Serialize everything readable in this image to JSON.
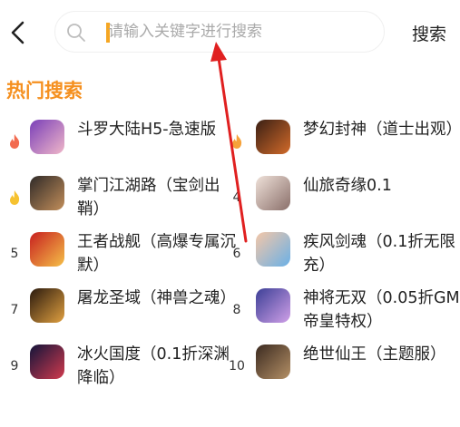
{
  "header": {
    "search_placeholder": "请输入关键字进行搜索",
    "search_button": "搜索"
  },
  "section_title": "热门搜索",
  "items": [
    {
      "rank": "1",
      "name": "斗罗大陆H5-急速版",
      "fire": true,
      "fire_color": "#f26b50"
    },
    {
      "rank": "2",
      "name": "梦幻封神（道士出观）",
      "fire": true,
      "fire_color": "#f6a23a"
    },
    {
      "rank": "3",
      "name": "掌门江湖路（宝剑出鞘）",
      "fire": true,
      "fire_color": "#f6c230"
    },
    {
      "rank": "4",
      "name": "仙旅奇缘0.1",
      "fire": false
    },
    {
      "rank": "5",
      "name": "王者战舰（高爆专属沉默）",
      "fire": false
    },
    {
      "rank": "6",
      "name": "疾风剑魂（0.1折无限充）",
      "fire": false
    },
    {
      "rank": "7",
      "name": "屠龙圣域（神兽之魂）",
      "fire": false
    },
    {
      "rank": "8",
      "name": "神将无双（0.05折GM帝皇特权）",
      "fire": false
    },
    {
      "rank": "9",
      "name": "冰火国度（0.1折深渊降临）",
      "fire": false
    },
    {
      "rank": "10",
      "name": "绝世仙王（主题服）",
      "fire": false
    }
  ],
  "colors": {
    "accent": "#f5901f",
    "annotation_arrow": "#e02020"
  }
}
